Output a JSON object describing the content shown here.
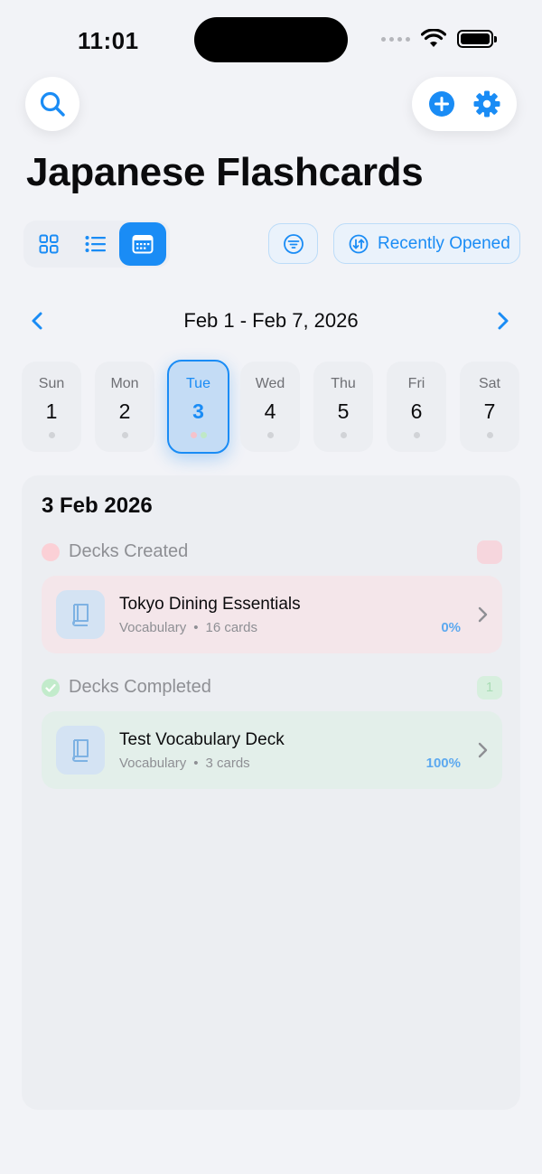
{
  "status_bar": {
    "time": "11:01"
  },
  "page": {
    "title": "Japanese Flashcards"
  },
  "toolbar": {
    "sort_label": "Recently Opened"
  },
  "week": {
    "range": "Feb 1 - Feb 7, 2026",
    "days": [
      {
        "name": "Sun",
        "num": "1"
      },
      {
        "name": "Mon",
        "num": "2"
      },
      {
        "name": "Tue",
        "num": "3"
      },
      {
        "name": "Wed",
        "num": "4"
      },
      {
        "name": "Thu",
        "num": "5"
      },
      {
        "name": "Fri",
        "num": "6"
      },
      {
        "name": "Sat",
        "num": "7"
      }
    ],
    "selected_index": 2
  },
  "detail": {
    "date": "3 Feb 2026",
    "created": {
      "title": "Decks Created",
      "badge": "",
      "deck": {
        "name": "Tokyo Dining Essentials",
        "type": "Vocabulary",
        "cards": "16 cards",
        "progress": "0%"
      }
    },
    "completed": {
      "title": "Decks Completed",
      "badge": "1",
      "deck": {
        "name": "Test Vocabulary Deck",
        "type": "Vocabulary",
        "cards": "3 cards",
        "progress": "100%"
      }
    }
  },
  "colors": {
    "accent": "#1a8cf5",
    "created_dot": "#fbd0d6",
    "completed_dot": "#6bd481",
    "created_card": "#f4e6ea",
    "completed_card": "#e3efea"
  }
}
